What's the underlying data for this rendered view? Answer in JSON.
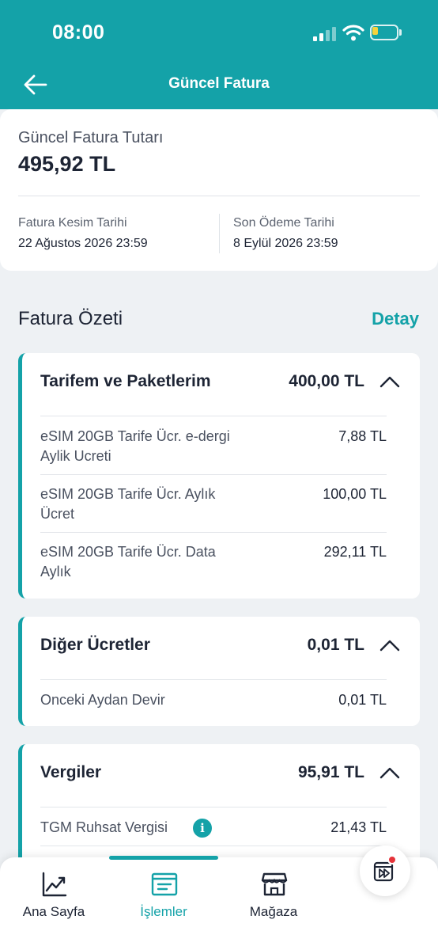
{
  "status_bar": {
    "time": "08:00"
  },
  "header": {
    "title": "Güncel Fatura"
  },
  "summary": {
    "total_label": "Güncel Fatura Tutarı",
    "total_value": "495,92 TL",
    "cut_date_label": "Fatura Kesim Tarihi",
    "cut_date_value": "22 Ağustos 2026 23:59",
    "due_date_label": "Son Ödeme Tarihi",
    "due_date_value": "8 Eylül 2026 23:59"
  },
  "invoice_summary": {
    "title": "Fatura Özeti",
    "detail_link": "Detay",
    "groups": [
      {
        "title": "Tarifem ve Paketlerim",
        "amount": "400,00 TL",
        "items": [
          {
            "label": "eSIM 20GB Tarife Ücr. e-dergi Aylik Ucreti",
            "amount": "7,88 TL"
          },
          {
            "label": "eSIM 20GB Tarife Ücr. Aylık Ücret",
            "amount": "100,00 TL"
          },
          {
            "label": "eSIM 20GB Tarife Ücr. Data Aylık",
            "amount": "292,11 TL"
          }
        ]
      },
      {
        "title": "Diğer Ücretler",
        "amount": "0,01 TL",
        "items": [
          {
            "label": "Onceki Aydan Devir",
            "amount": "0,01 TL"
          }
        ]
      },
      {
        "title": "Vergiler",
        "amount": "95,91 TL",
        "items": [
          {
            "label": "TGM Ruhsat Vergisi",
            "amount": "21,43 TL"
          }
        ]
      }
    ]
  },
  "info_icon_glyph": "i",
  "bottom_nav": {
    "items": [
      {
        "label": "Ana Sayfa",
        "icon": "chart-line-icon"
      },
      {
        "label": "İşlemler",
        "icon": "receipt-list-icon"
      },
      {
        "label": "Mağaza",
        "icon": "store-icon"
      }
    ],
    "active_index": 1
  },
  "colors": {
    "accent": "#14a2a8",
    "text": "#1d2434",
    "notification": "#e5333a",
    "background": "#eef1f4"
  }
}
